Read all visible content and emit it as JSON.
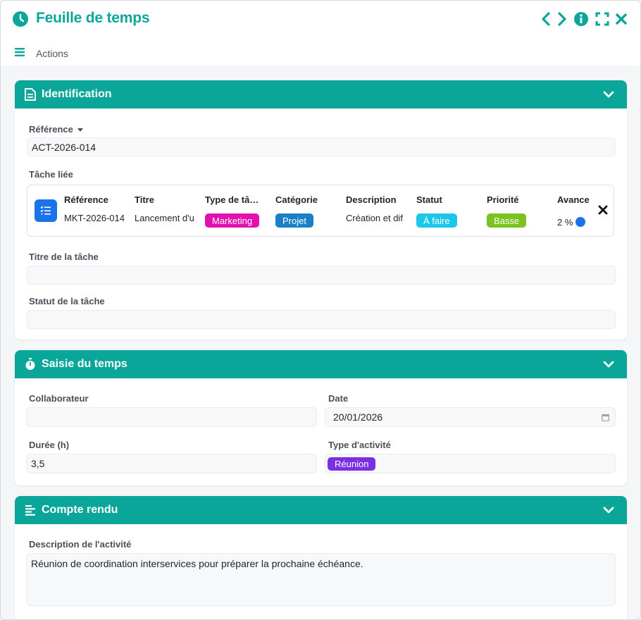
{
  "window": {
    "title": "Feuille de temps",
    "actions_label": "Actions",
    "accent_color": "#0aa69a"
  },
  "toolbar": {
    "icons": [
      "chevron-left-icon",
      "chevron-right-icon",
      "info-icon",
      "fullscreen-icon",
      "close-icon"
    ]
  },
  "identification": {
    "title": "Identification",
    "reference_label": "Référence",
    "reference_value": "ACT-2026-014",
    "linked_task_label": "Tâche liée",
    "linked_task": {
      "headers": [
        "Référence",
        "Titre",
        "Type de tâ…",
        "Catégorie",
        "Description",
        "Statut",
        "Priorité",
        "Avance"
      ],
      "reference": "MKT-2026-014",
      "title": "Lancement d'u",
      "type": "Marketing",
      "category": "Projet",
      "description": "Création et dif",
      "status": "À faire",
      "priority": "Basse",
      "progress_text": "2 %"
    },
    "task_title_label": "Titre de la tâche",
    "task_title_value": "",
    "task_status_label": "Statut de la tâche",
    "task_status_value": ""
  },
  "time_entry": {
    "title": "Saisie du temps",
    "collaborator_label": "Collaborateur",
    "collaborator_value": "",
    "date_label": "Date",
    "date_value": "20/01/2026",
    "duration_label": "Durée (h)",
    "duration_value": "3,5",
    "activity_type_label": "Type d'activité",
    "activity_type_value": "Réunion"
  },
  "report": {
    "title": "Compte rendu",
    "description_label": "Description de l'activité",
    "description_value": "Réunion de coordination interservices pour préparer la prochaine échéance."
  },
  "colors": {
    "marketing": "#e30fae",
    "projet": "#1a7fc9",
    "a_faire": "#1cc6e8",
    "basse": "#7ac21f",
    "reunion": "#7b2fe0"
  }
}
